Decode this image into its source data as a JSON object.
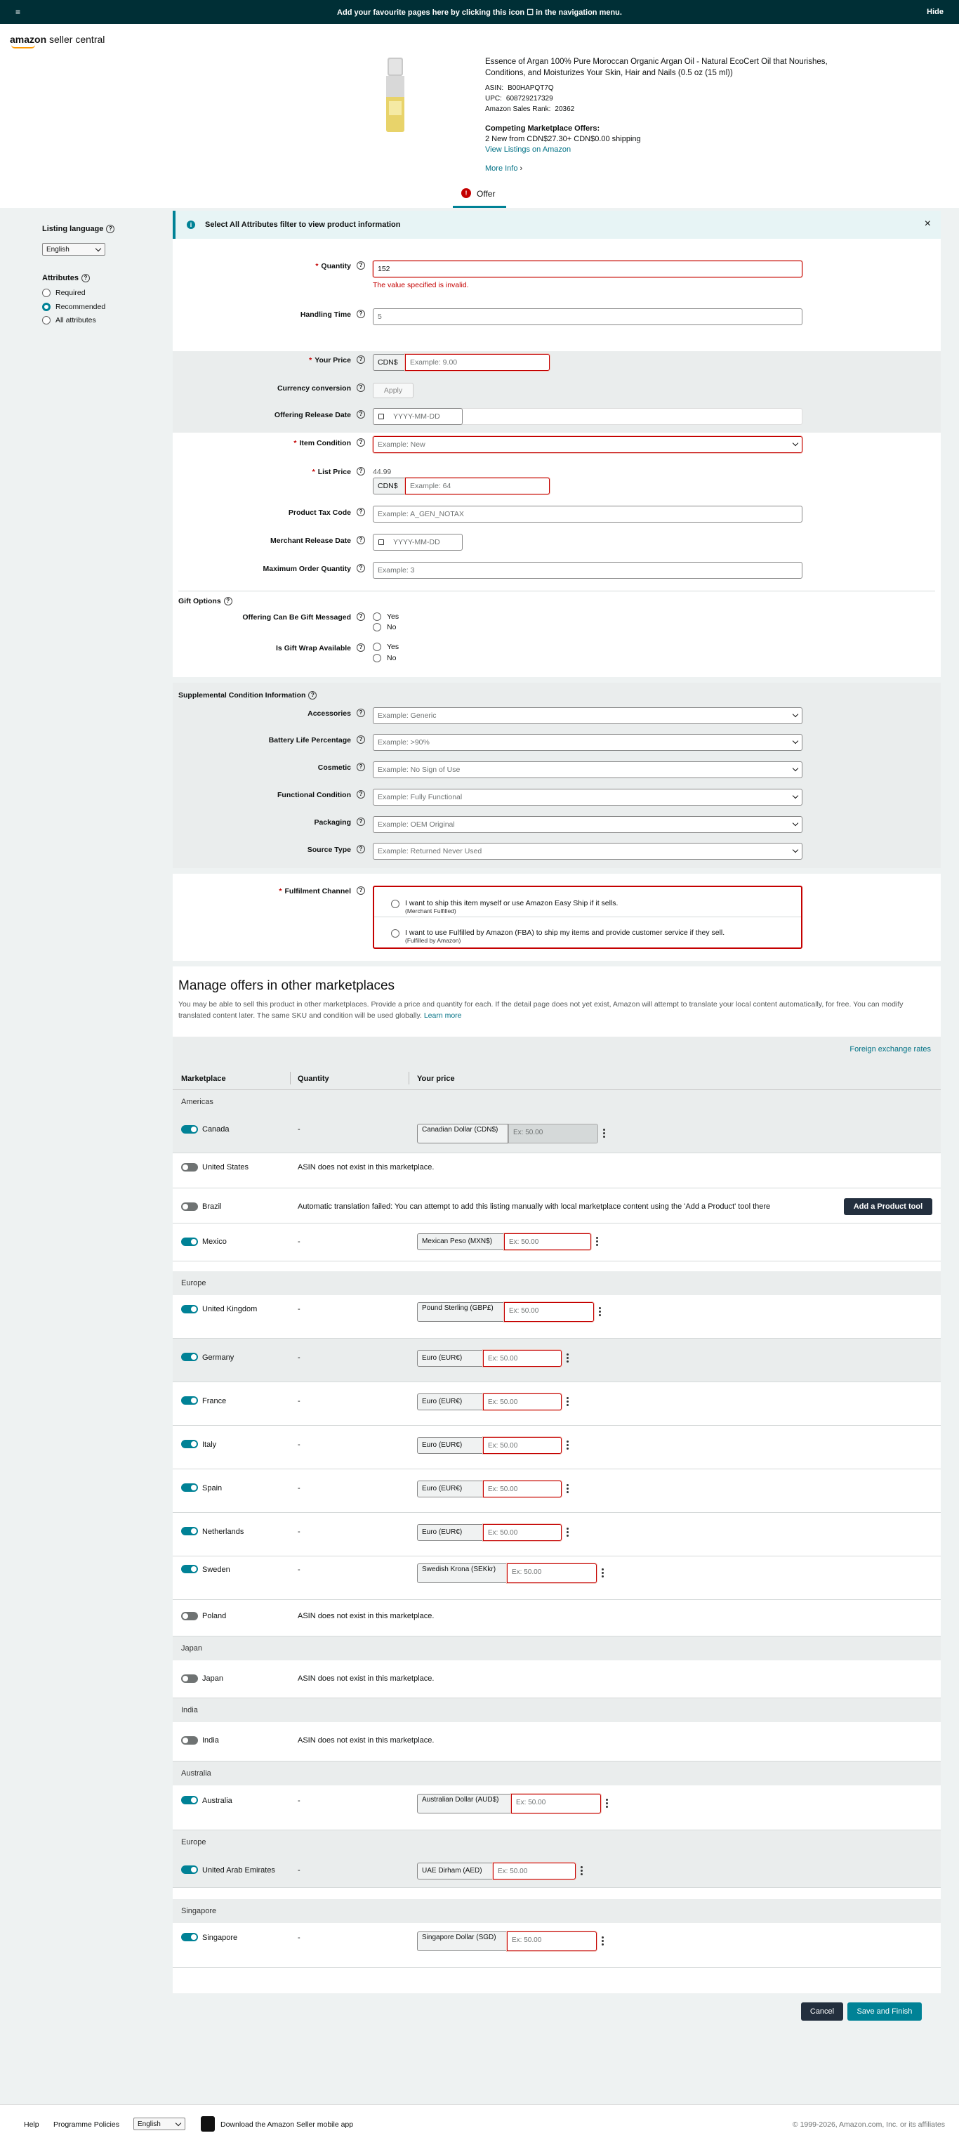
{
  "topbar": {
    "menu_icon": "≡",
    "message": "Add your favourite pages here by clicking this icon ☐ in the navigation menu.",
    "hide": "Hide"
  },
  "logo": {
    "brand": "amazon",
    "suffix": " seller central"
  },
  "product": {
    "title": "Essence of Argan 100% Pure Moroccan Organic Argan Oil - Natural EcoCert Oil that Nourishes, Conditions, and Moisturizes Your Skin, Hair and Nails (0.5 oz (15 ml))",
    "asin_label": "ASIN:",
    "asin": "B00HAPQT7Q",
    "upc_label": "UPC:",
    "upc": "608729217329",
    "rank_label": "Amazon Sales Rank:",
    "rank": "20362",
    "competing_label": "Competing Marketplace Offers:",
    "competing_offers": "2 New  from CDN$27.30+ CDN$0.00 shipping",
    "view_listings": "View Listings on Amazon",
    "more_info": "More Info"
  },
  "tab": {
    "badge": "!",
    "label": "Offer"
  },
  "sidebar": {
    "language_label": "Listing language",
    "language_value": "English",
    "attributes_label": "Attributes",
    "options": [
      "Required",
      "Recommended",
      "All attributes"
    ]
  },
  "banner": {
    "text": "Select All Attributes filter to view product information",
    "close": "×"
  },
  "form": {
    "quantity": {
      "label": "Quantity",
      "value": "152",
      "error": "The value specified is invalid."
    },
    "handling_time": {
      "label": "Handling Time",
      "value": "5"
    },
    "your_price": {
      "label": "Your Price",
      "currency": "CDN$",
      "placeholder": "Example: 9.00"
    },
    "currency_conversion": {
      "label": "Currency conversion",
      "button": "Apply"
    },
    "offering_release_date": {
      "label": "Offering Release Date",
      "placeholder": "YYYY-MM-DD"
    },
    "item_condition": {
      "label": "Item Condition",
      "placeholder": "Example: New"
    },
    "list_price": {
      "label": "List Price",
      "hint": "44.99",
      "currency": "CDN$",
      "placeholder": "Example: 64"
    },
    "product_tax_code": {
      "label": "Product Tax Code",
      "placeholder": "Example: A_GEN_NOTAX"
    },
    "merchant_release_date": {
      "label": "Merchant Release Date",
      "placeholder": "YYYY-MM-DD"
    },
    "max_order_qty": {
      "label": "Maximum Order Quantity",
      "placeholder": "Example: 3"
    },
    "gift_options": {
      "title": "Gift Options",
      "gift_message": "Offering Can Be Gift Messaged",
      "gift_wrap": "Is Gift Wrap Available",
      "yes": "Yes",
      "no": "No"
    },
    "supplemental": {
      "title": "Supplemental Condition Information",
      "fields": [
        {
          "label": "Accessories",
          "placeholder": "Example: Generic"
        },
        {
          "label": "Battery Life Percentage",
          "placeholder": "Example: >90%"
        },
        {
          "label": "Cosmetic",
          "placeholder": "Example: No Sign of Use"
        },
        {
          "label": "Functional Condition",
          "placeholder": "Example: Fully Functional"
        },
        {
          "label": "Packaging",
          "placeholder": "Example: OEM Original"
        },
        {
          "label": "Source Type",
          "placeholder": "Example: Returned Never Used"
        }
      ]
    },
    "fulfillment": {
      "label": "Fulfilment Channel",
      "opt1": "I want to ship this item myself or use Amazon Easy Ship if it sells.",
      "opt1_sub": "(Merchant Fulfilled)",
      "opt2": "I want to use Fulfilled by Amazon (FBA) to ship my items and provide customer service if they sell.",
      "opt2_sub": "(Fulfilled by Amazon)"
    }
  },
  "marketplaces": {
    "title": "Manage offers in other marketplaces",
    "desc": "You may be able to sell this product in other marketplaces. Provide a price and quantity for each. If the detail page does not yet exist, Amazon will attempt to translate your local content automatically, for free. You can modify translated content later. The same SKU and condition will be used globally.",
    "learn_more": "Learn more",
    "fx_link": "Foreign exchange rates",
    "headers": [
      "Marketplace",
      "Quantity",
      "Your price"
    ],
    "regions": {
      "americas": "Americas",
      "europe": "Europe",
      "japan": "Japan",
      "india": "India",
      "australia": "Australia",
      "europe2": "Europe",
      "singapore": "Singapore"
    },
    "dash": "-",
    "rows": {
      "canada": {
        "name": "Canada",
        "currency": "Canadian Dollar (CDN$)",
        "placeholder": "Ex: 50.00"
      },
      "us": {
        "name": "United States",
        "msg": "ASIN does not exist in this marketplace."
      },
      "brazil": {
        "name": "Brazil",
        "msg": "Automatic translation failed: You can attempt to add this listing manually with local marketplace content using the 'Add a Product' tool there",
        "button": "Add a Product tool"
      },
      "mexico": {
        "name": "Mexico",
        "currency": "Mexican Peso (MXN$)",
        "placeholder": "Ex: 50.00"
      },
      "uk": {
        "name": "United Kingdom",
        "currency": "Pound Sterling (GBP£)",
        "placeholder": "Ex: 50.00"
      },
      "germany": {
        "name": "Germany",
        "currency": "Euro (EUR€)",
        "placeholder": "Ex: 50.00"
      },
      "france": {
        "name": "France",
        "currency": "Euro (EUR€)",
        "placeholder": "Ex: 50.00"
      },
      "italy": {
        "name": "Italy",
        "currency": "Euro (EUR€)",
        "placeholder": "Ex: 50.00"
      },
      "spain": {
        "name": "Spain",
        "currency": "Euro (EUR€)",
        "placeholder": "Ex: 50.00"
      },
      "netherlands": {
        "name": "Netherlands",
        "currency": "Euro (EUR€)",
        "placeholder": "Ex: 50.00"
      },
      "sweden": {
        "name": "Sweden",
        "currency": "Swedish Krona (SEKkr)",
        "placeholder": "Ex: 50.00"
      },
      "poland": {
        "name": "Poland",
        "msg": "ASIN does not exist in this marketplace."
      },
      "japan": {
        "name": "Japan",
        "msg": "ASIN does not exist in this marketplace."
      },
      "india": {
        "name": "India",
        "msg": "ASIN does not exist in this marketplace."
      },
      "australia": {
        "name": "Australia",
        "currency": "Australian Dollar (AUD$)",
        "placeholder": "Ex: 50.00"
      },
      "uae": {
        "name": "United Arab Emirates",
        "currency": "UAE Dirham (AED)",
        "placeholder": "Ex: 50.00"
      },
      "singapore": {
        "name": "Singapore",
        "currency": "Singapore Dollar (SGD)",
        "placeholder": "Ex: 50.00"
      }
    }
  },
  "actions": {
    "cancel": "Cancel",
    "save": "Save and Finish"
  },
  "footer": {
    "help": "Help",
    "policies": "Programme Policies",
    "language": "English",
    "app": "Download the Amazon Seller mobile app",
    "copyright": "© 1999-2026, Amazon.com, Inc. or its affiliates"
  },
  "colors": {
    "accent": "#008296",
    "error": "#c40000",
    "topbar": "#002f36",
    "dark_button": "#232f3e"
  }
}
